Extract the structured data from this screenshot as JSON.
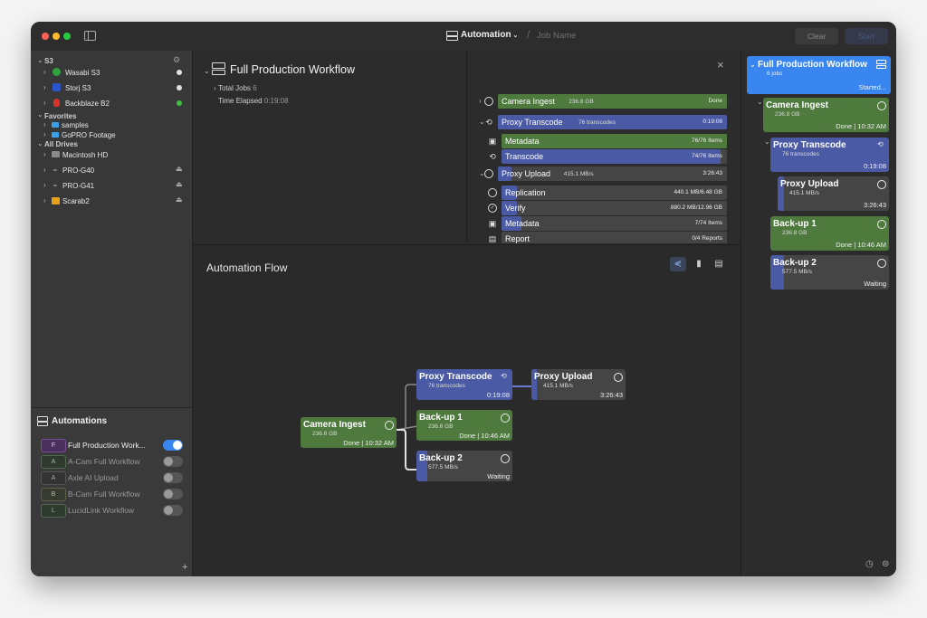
{
  "titlebar": {
    "app_menu": "Automation",
    "job_name_placeholder": "Job Name",
    "clear_label": "Clear",
    "start_label": "Start"
  },
  "sidebar": {
    "sections": {
      "s3": "S3",
      "favorites": "Favorites",
      "all_drives": "All Drives"
    },
    "s3_items": [
      {
        "label": "Wasabi S3",
        "status_color": "#e0e0e0"
      },
      {
        "label": "Storj S3",
        "status_color": "#e0e0e0"
      },
      {
        "label": "Backblaze B2",
        "status_color": "#3cc23c"
      }
    ],
    "favorites": [
      {
        "label": "samples"
      },
      {
        "label": "GoPRO Footage"
      }
    ],
    "drives": [
      {
        "label": "Macintosh HD"
      },
      {
        "label": "PRO-G40"
      },
      {
        "label": "PRO-G41"
      },
      {
        "label": "Scarab2"
      }
    ],
    "automations_title": "Automations",
    "automations": [
      {
        "badge": "F",
        "label": "Full Production Work...",
        "enabled": true
      },
      {
        "badge": "A",
        "label": "A-Cam Full Workflow",
        "enabled": false
      },
      {
        "badge": "A",
        "label": "Axle AI Upload",
        "enabled": false
      },
      {
        "badge": "B",
        "label": "B-Cam Full Workflow",
        "enabled": false
      },
      {
        "badge": "L",
        "label": "LucidLink Workflow",
        "enabled": false
      }
    ],
    "add_label": "+"
  },
  "workflow": {
    "title": "Full Production Workflow",
    "total_jobs_label": "Total Jobs",
    "total_jobs_value": "6",
    "time_elapsed_label": "Time Elapsed",
    "time_elapsed_value": "0:19:08"
  },
  "jobs": [
    {
      "label": "Camera Ingest",
      "sub": "236.8 GB",
      "value": "Done",
      "color": "#4e7a3e",
      "progress": 1.0
    },
    {
      "label": "Proxy Transcode",
      "sub": "76 transcodes",
      "value": "0:19:08",
      "color": "#4b5aa4",
      "progress": 1.0
    },
    {
      "label": "Metadata",
      "sub": "",
      "value": "76/76 Items",
      "color": "#4e7a3e",
      "progress": 1.0
    },
    {
      "label": "Transcode",
      "sub": "",
      "value": "74/76 Items",
      "color": "#4b5aa4",
      "progress": 0.97
    },
    {
      "label": "Proxy Upload",
      "sub": "415.1 MB/s",
      "value": "3:26:43",
      "color": "#4b5aa4",
      "progress": 0.06
    },
    {
      "label": "Replication",
      "sub": "",
      "value": "440.1 MB/6.48 GB",
      "color": "#4b5aa4",
      "progress": 0.07
    },
    {
      "label": "Verify",
      "sub": "",
      "value": "880.2 MB/12.96 GB",
      "color": "#4b5aa4",
      "progress": 0.07
    },
    {
      "label": "Metadata",
      "sub": "",
      "value": "7/74 Items",
      "color": "#4b5aa4",
      "progress": 0.09
    },
    {
      "label": "Report",
      "sub": "",
      "value": "0/4 Reports",
      "color": "#4b5aa4",
      "progress": 0.0
    }
  ],
  "flow": {
    "title": "Automation Flow",
    "nodes": {
      "camera_ingest": {
        "title": "Camera Ingest",
        "sub": "236.8 GB",
        "status": "Done | 10:32 AM"
      },
      "proxy_transcode": {
        "title": "Proxy Transcode",
        "sub": "76 transcodes",
        "status": "0:19:08"
      },
      "proxy_upload": {
        "title": "Proxy Upload",
        "sub": "415.1 MB/s",
        "status": "3:26:43"
      },
      "backup1": {
        "title": "Back-up 1",
        "sub": "236.8 GB",
        "status": "Done | 10:46 AM"
      },
      "backup2": {
        "title": "Back-up 2",
        "sub": "577.5 MB/s",
        "status": "Waiting"
      }
    }
  },
  "right_panel": {
    "header": {
      "title": "Full Production Workflow",
      "sub": "6 jobs",
      "status": "Started..."
    },
    "cards": [
      {
        "title": "Camera Ingest",
        "sub": "236.8 GB",
        "status": "Done | 10:32 AM"
      },
      {
        "title": "Proxy Transcode",
        "sub": "76 transcodes",
        "status": "0:19:08"
      },
      {
        "title": "Proxy Upload",
        "sub": "415.1 MB/s",
        "status": "3:26:43"
      },
      {
        "title": "Back-up 1",
        "sub": "236.8 GB",
        "status": "Done | 10:46 AM"
      },
      {
        "title": "Back-up 2",
        "sub": "577.5 MB/s",
        "status": "Waiting"
      }
    ]
  },
  "colors": {
    "green": "#4e7a3e",
    "blue": "#4b5aa4",
    "accent": "#3a86f0",
    "gray_card": "#454545"
  }
}
